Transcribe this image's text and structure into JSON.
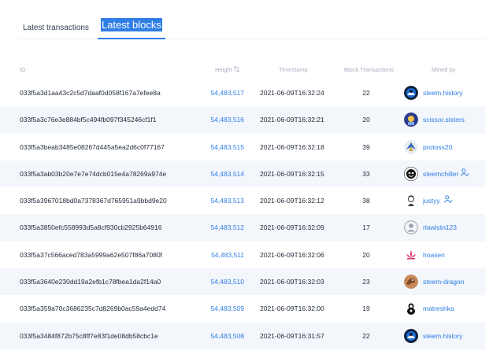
{
  "tabs": [
    {
      "label": "Latest transactions"
    },
    {
      "label": "Latest blocks"
    }
  ],
  "table": {
    "headers": {
      "id": "ID",
      "height": "Height",
      "timestamp": "Timestamp",
      "block_transactions": "Block Transactions",
      "mined_by": "Mined by"
    },
    "rows": [
      {
        "id": "033f5a3d1aa43c2c5d7daaf0d058f167a7efee8a",
        "height": "54,483,517",
        "timestamp": "2021-06-09T16:32:24",
        "tx": "22",
        "miner": "steem.history",
        "avatar": "steem-history-avatar",
        "badge": false
      },
      {
        "id": "033f5a3c76e3e884bf5c494fb097f345246cf1f1",
        "height": "54,483,516",
        "timestamp": "2021-06-09T16:32:21",
        "tx": "20",
        "miner": "scissor.sisters",
        "avatar": "scissor-sisters-avatar",
        "badge": false
      },
      {
        "id": "033f5a3beab3485e08267d445a5ea2d6c0f77167",
        "height": "54,483,515",
        "timestamp": "2021-06-09T16:32:18",
        "tx": "39",
        "miner": "protoss20",
        "avatar": "protoss20-avatar",
        "badge": false
      },
      {
        "id": "033f5a3ab03b20e7e7e74dcb015e4a78269a974e",
        "height": "54,483,514",
        "timestamp": "2021-06-09T16:32:15",
        "tx": "33",
        "miner": "steemchiller",
        "avatar": "steemchiller-avatar",
        "badge": true
      },
      {
        "id": "033f5a3967018bd0a7378367d765951a9bbd9e20",
        "height": "54,483,513",
        "timestamp": "2021-06-09T16:32:12",
        "tx": "38",
        "miner": "justyy",
        "avatar": "justyy-avatar",
        "badge": true
      },
      {
        "id": "033f5a3850efc558993d5a8cf930cb2925b64916",
        "height": "54,483,512",
        "timestamp": "2021-06-09T16:32:09",
        "tx": "17",
        "miner": "rlawlstn123",
        "avatar": "default-user-avatar",
        "badge": false
      },
      {
        "id": "033f5a37c566aced783a5999a62e507f86a7080f",
        "height": "54,483,511",
        "timestamp": "2021-06-09T16:32:06",
        "tx": "20",
        "miner": "hoasen",
        "avatar": "hoasen-lotus-avatar",
        "badge": false
      },
      {
        "id": "033f5a3640e230dd19a2efb1c78fbea1da2f14a0",
        "height": "54,483,510",
        "timestamp": "2021-06-09T16:32:03",
        "tx": "23",
        "miner": "steem-dragon",
        "avatar": "steem-dragon-avatar",
        "badge": false
      },
      {
        "id": "033f5a359a70c3686235c7d8269b0ac59a4edd74",
        "height": "54,483,509",
        "timestamp": "2021-06-09T16:32:00",
        "tx": "19",
        "miner": "matreshka",
        "avatar": "matreshka-avatar",
        "badge": false
      },
      {
        "id": "033f5a3484f872b75c8ff7e83f1de08db58cbc1e",
        "height": "54,483,508",
        "timestamp": "2021-06-09T16:31:57",
        "tx": "22",
        "miner": "steem.history",
        "avatar": "steem-history-avatar",
        "badge": false
      }
    ]
  },
  "colors": {
    "accent": "#2f7ee6",
    "row_alt": "#f3f6fb",
    "header_text": "#a7b0bd"
  },
  "icons": {
    "sort": "sort-arrows-icon",
    "witness_badge": "user-check-icon"
  }
}
